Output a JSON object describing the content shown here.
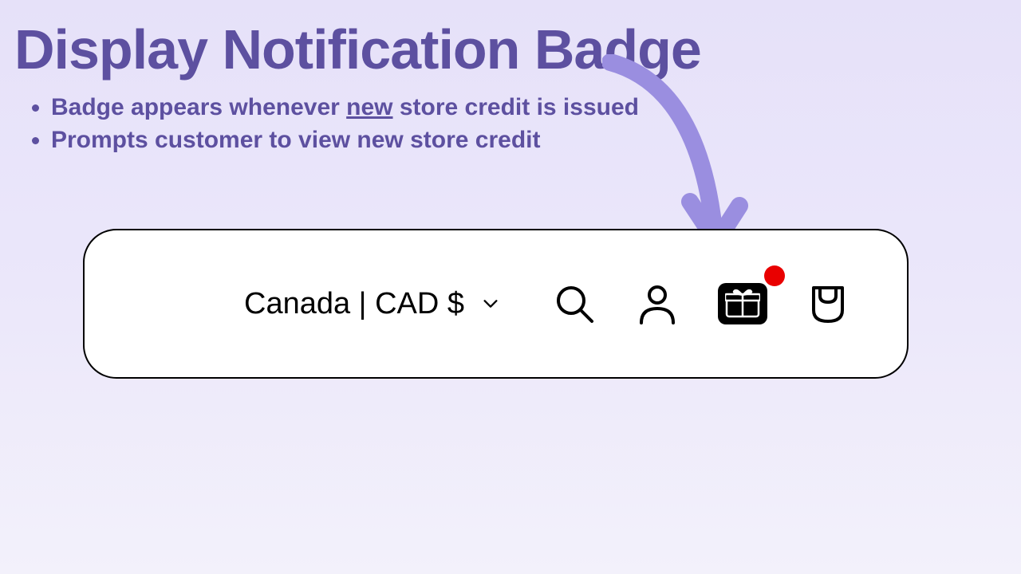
{
  "title": "Display Notification Badge",
  "bullets": {
    "b1_pre": "Badge appears whenever ",
    "b1_underlined": "new",
    "b1_post": " store credit is issued",
    "b2": "Prompts customer to view new store credit"
  },
  "navbar": {
    "currency_label": "Canada | CAD $"
  },
  "colors": {
    "accent": "#5d50a0",
    "arrow": "#9a8ee0",
    "badge": "#e90000"
  }
}
